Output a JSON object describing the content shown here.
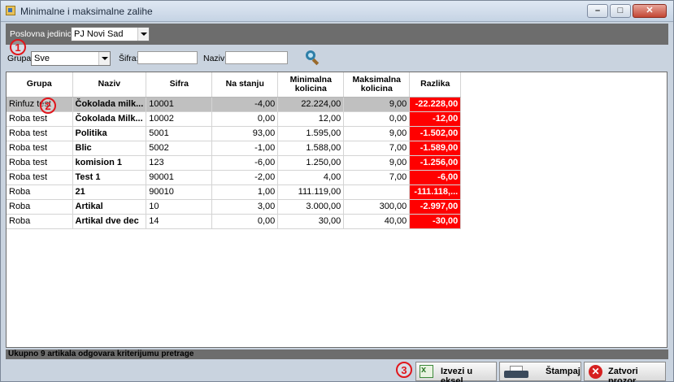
{
  "window": {
    "title": "Minimalne i maksimalne zalihe",
    "controls": {
      "minimize": "–",
      "maximize": "□",
      "close": "✕"
    }
  },
  "topbar": {
    "poslovna_label": "Poslovna jedinica:",
    "poslovna_value": "PJ Novi Sad"
  },
  "filters": {
    "grupa_label": "Grupa:",
    "grupa_value": "Sve",
    "sifra_label": "Šifra:",
    "sifra_value": "",
    "naziv_label": "Naziv:",
    "naziv_value": ""
  },
  "table": {
    "headers": [
      "Grupa",
      "Naziv",
      "Sifra",
      "Na stanju",
      "Minimalna kolicina",
      "Maksimalna kolicina",
      "Razlika"
    ],
    "rows": [
      {
        "grupa": "Rinfuz test",
        "naziv": "Čokolada milk...",
        "sifra": "10001",
        "na_stanju": "-4,00",
        "min": "22.224,00",
        "max": "9,00",
        "razlika": "-22.228,00",
        "selected": true
      },
      {
        "grupa": "Roba test",
        "naziv": "Čokolada Milk...",
        "sifra": "10002",
        "na_stanju": "0,00",
        "min": "12,00",
        "max": "0,00",
        "razlika": "-12,00"
      },
      {
        "grupa": "Roba test",
        "naziv": "Politika",
        "sifra": "5001",
        "na_stanju": "93,00",
        "min": "1.595,00",
        "max": "9,00",
        "razlika": "-1.502,00"
      },
      {
        "grupa": "Roba test",
        "naziv": "Blic",
        "sifra": "5002",
        "na_stanju": "-1,00",
        "min": "1.588,00",
        "max": "7,00",
        "razlika": "-1.589,00"
      },
      {
        "grupa": "Roba test",
        "naziv": "komision 1",
        "sifra": "123",
        "na_stanju": "-6,00",
        "min": "1.250,00",
        "max": "9,00",
        "razlika": "-1.256,00"
      },
      {
        "grupa": "Roba test",
        "naziv": "Test 1",
        "sifra": "90001",
        "na_stanju": "-2,00",
        "min": "4,00",
        "max": "7,00",
        "razlika": "-6,00"
      },
      {
        "grupa": "Roba",
        "naziv": "21",
        "sifra": "90010",
        "na_stanju": "1,00",
        "min": "111.119,00",
        "max": "",
        "razlika": "-111.118,..."
      },
      {
        "grupa": "Roba",
        "naziv": "Artikal",
        "sifra": "10",
        "na_stanju": "3,00",
        "min": "3.000,00",
        "max": "300,00",
        "razlika": "-2.997,00"
      },
      {
        "grupa": "Roba",
        "naziv": "Artikal dve dec",
        "sifra": "14",
        "na_stanju": "0,00",
        "min": "30,00",
        "max": "40,00",
        "razlika": "-30,00"
      }
    ]
  },
  "status": {
    "text": "Ukupno 9 artikala odgovara kriterijumu pretrage"
  },
  "buttons": {
    "export_label": "Izvezi u eksel",
    "print_label": "Štampaj",
    "close_label": "Zatvori prozor"
  },
  "markers": {
    "m1": "1",
    "m2": "2",
    "m3": "3"
  },
  "colors": {
    "diff_bg": "#ff0000",
    "marker": "#e0161c",
    "bar_bg": "#6d6d6d"
  },
  "icons": {
    "search": "search-icon",
    "excel": "excel-icon",
    "print": "printer-icon",
    "close": "close-icon"
  }
}
